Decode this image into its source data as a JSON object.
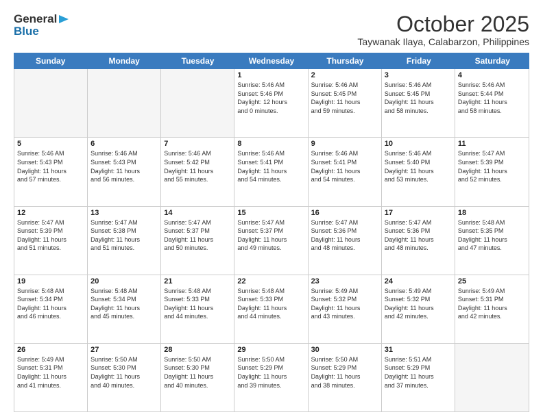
{
  "header": {
    "logo_general": "General",
    "logo_blue": "Blue",
    "title": "October 2025",
    "subtitle": "Taywanak Ilaya, Calabarzon, Philippines"
  },
  "calendar": {
    "days_of_week": [
      "Sunday",
      "Monday",
      "Tuesday",
      "Wednesday",
      "Thursday",
      "Friday",
      "Saturday"
    ],
    "weeks": [
      [
        {
          "day": "",
          "info": ""
        },
        {
          "day": "",
          "info": ""
        },
        {
          "day": "",
          "info": ""
        },
        {
          "day": "1",
          "info": "Sunrise: 5:46 AM\nSunset: 5:46 PM\nDaylight: 12 hours\nand 0 minutes."
        },
        {
          "day": "2",
          "info": "Sunrise: 5:46 AM\nSunset: 5:45 PM\nDaylight: 11 hours\nand 59 minutes."
        },
        {
          "day": "3",
          "info": "Sunrise: 5:46 AM\nSunset: 5:45 PM\nDaylight: 11 hours\nand 58 minutes."
        },
        {
          "day": "4",
          "info": "Sunrise: 5:46 AM\nSunset: 5:44 PM\nDaylight: 11 hours\nand 58 minutes."
        }
      ],
      [
        {
          "day": "5",
          "info": "Sunrise: 5:46 AM\nSunset: 5:43 PM\nDaylight: 11 hours\nand 57 minutes."
        },
        {
          "day": "6",
          "info": "Sunrise: 5:46 AM\nSunset: 5:43 PM\nDaylight: 11 hours\nand 56 minutes."
        },
        {
          "day": "7",
          "info": "Sunrise: 5:46 AM\nSunset: 5:42 PM\nDaylight: 11 hours\nand 55 minutes."
        },
        {
          "day": "8",
          "info": "Sunrise: 5:46 AM\nSunset: 5:41 PM\nDaylight: 11 hours\nand 54 minutes."
        },
        {
          "day": "9",
          "info": "Sunrise: 5:46 AM\nSunset: 5:41 PM\nDaylight: 11 hours\nand 54 minutes."
        },
        {
          "day": "10",
          "info": "Sunrise: 5:46 AM\nSunset: 5:40 PM\nDaylight: 11 hours\nand 53 minutes."
        },
        {
          "day": "11",
          "info": "Sunrise: 5:47 AM\nSunset: 5:39 PM\nDaylight: 11 hours\nand 52 minutes."
        }
      ],
      [
        {
          "day": "12",
          "info": "Sunrise: 5:47 AM\nSunset: 5:39 PM\nDaylight: 11 hours\nand 51 minutes."
        },
        {
          "day": "13",
          "info": "Sunrise: 5:47 AM\nSunset: 5:38 PM\nDaylight: 11 hours\nand 51 minutes."
        },
        {
          "day": "14",
          "info": "Sunrise: 5:47 AM\nSunset: 5:37 PM\nDaylight: 11 hours\nand 50 minutes."
        },
        {
          "day": "15",
          "info": "Sunrise: 5:47 AM\nSunset: 5:37 PM\nDaylight: 11 hours\nand 49 minutes."
        },
        {
          "day": "16",
          "info": "Sunrise: 5:47 AM\nSunset: 5:36 PM\nDaylight: 11 hours\nand 48 minutes."
        },
        {
          "day": "17",
          "info": "Sunrise: 5:47 AM\nSunset: 5:36 PM\nDaylight: 11 hours\nand 48 minutes."
        },
        {
          "day": "18",
          "info": "Sunrise: 5:48 AM\nSunset: 5:35 PM\nDaylight: 11 hours\nand 47 minutes."
        }
      ],
      [
        {
          "day": "19",
          "info": "Sunrise: 5:48 AM\nSunset: 5:34 PM\nDaylight: 11 hours\nand 46 minutes."
        },
        {
          "day": "20",
          "info": "Sunrise: 5:48 AM\nSunset: 5:34 PM\nDaylight: 11 hours\nand 45 minutes."
        },
        {
          "day": "21",
          "info": "Sunrise: 5:48 AM\nSunset: 5:33 PM\nDaylight: 11 hours\nand 44 minutes."
        },
        {
          "day": "22",
          "info": "Sunrise: 5:48 AM\nSunset: 5:33 PM\nDaylight: 11 hours\nand 44 minutes."
        },
        {
          "day": "23",
          "info": "Sunrise: 5:49 AM\nSunset: 5:32 PM\nDaylight: 11 hours\nand 43 minutes."
        },
        {
          "day": "24",
          "info": "Sunrise: 5:49 AM\nSunset: 5:32 PM\nDaylight: 11 hours\nand 42 minutes."
        },
        {
          "day": "25",
          "info": "Sunrise: 5:49 AM\nSunset: 5:31 PM\nDaylight: 11 hours\nand 42 minutes."
        }
      ],
      [
        {
          "day": "26",
          "info": "Sunrise: 5:49 AM\nSunset: 5:31 PM\nDaylight: 11 hours\nand 41 minutes."
        },
        {
          "day": "27",
          "info": "Sunrise: 5:50 AM\nSunset: 5:30 PM\nDaylight: 11 hours\nand 40 minutes."
        },
        {
          "day": "28",
          "info": "Sunrise: 5:50 AM\nSunset: 5:30 PM\nDaylight: 11 hours\nand 40 minutes."
        },
        {
          "day": "29",
          "info": "Sunrise: 5:50 AM\nSunset: 5:29 PM\nDaylight: 11 hours\nand 39 minutes."
        },
        {
          "day": "30",
          "info": "Sunrise: 5:50 AM\nSunset: 5:29 PM\nDaylight: 11 hours\nand 38 minutes."
        },
        {
          "day": "31",
          "info": "Sunrise: 5:51 AM\nSunset: 5:29 PM\nDaylight: 11 hours\nand 37 minutes."
        },
        {
          "day": "",
          "info": ""
        }
      ]
    ]
  }
}
